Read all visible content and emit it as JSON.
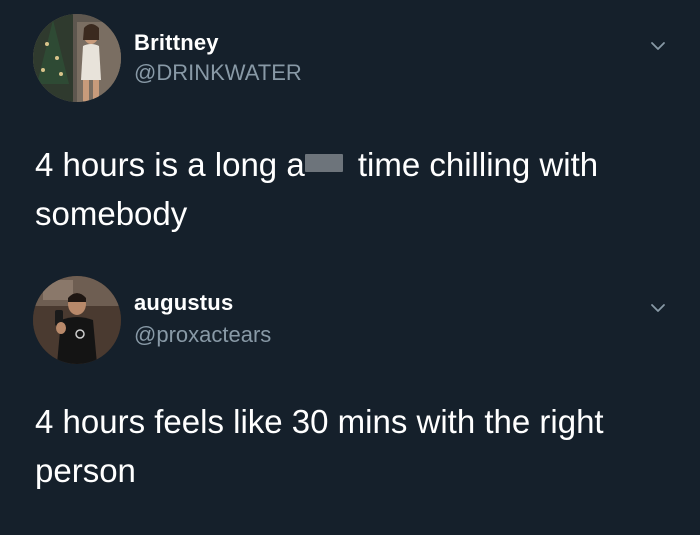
{
  "tweets": [
    {
      "display_name": "Brittney",
      "handle": "@DRINKWATER",
      "text_before": "4 hours is a long a",
      "text_after": " time chilling with somebody",
      "avatar_icon": "profile-photo",
      "menu_icon": "chevron-down-icon"
    },
    {
      "display_name": "augustus",
      "handle": "@proxactears",
      "text": "4 hours feels like 30 mins with the right person",
      "avatar_icon": "profile-photo",
      "menu_icon": "chevron-down-icon"
    }
  ],
  "colors": {
    "background": "#15202b",
    "primary_text": "#ffffff",
    "secondary_text": "#8899a6",
    "censor_bar": "#6d747b"
  }
}
